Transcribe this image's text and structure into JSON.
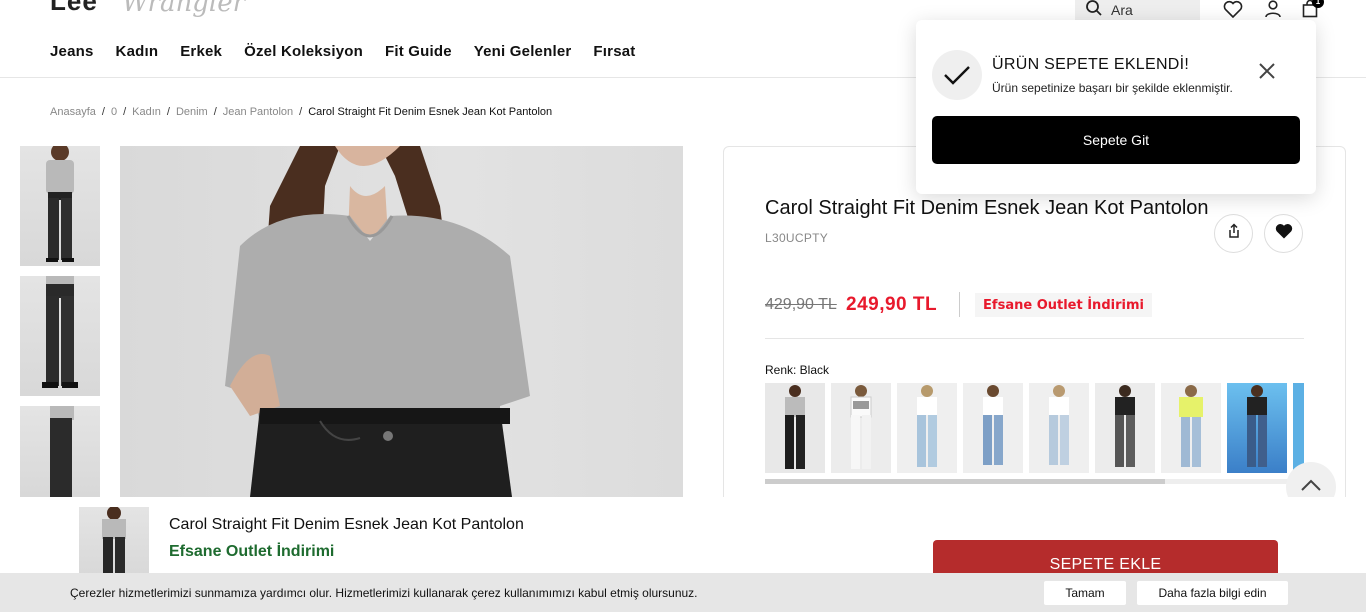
{
  "header": {
    "logo_primary": "Lee",
    "logo_secondary": "Wrangler",
    "search_placeholder": "Ara",
    "cart_count": "1",
    "nav": [
      "Jeans",
      "Kadın",
      "Erkek",
      "Özel Koleksiyon",
      "Fit Guide",
      "Yeni Gelenler",
      "Fırsat"
    ]
  },
  "breadcrumb": {
    "items": [
      "Anasayfa",
      "0",
      "Kadın",
      "Denim",
      "Jean Pantolon"
    ],
    "current": "Carol Straight Fit Denim Esnek Jean Kot Pantolon",
    "separator": "/"
  },
  "product": {
    "title": "Carol Straight Fit Denim Esnek Jean Kot Pantolon",
    "sku": "L30UCPTY",
    "old_price": "429,90 TL",
    "new_price": "249,90 TL",
    "promo": "Efsane Outlet İndirimi",
    "color_label": "Renk: Black",
    "price_color": "#e8192c"
  },
  "toast": {
    "title": "ÜRÜN SEPETE EKLENDİ!",
    "message": "Ürün sepetinize başarı bir şekilde eklenmiştir.",
    "button": "Sepete Git"
  },
  "sticky": {
    "title": "Carol Straight Fit Denim Esnek Jean Kot Pantolon",
    "promo": "Efsane Outlet İndirimi",
    "add_to_cart": "SEPETE EKLE",
    "add_color": "#b52c2c",
    "promo_color": "#1e6b2f"
  },
  "cookie": {
    "text": "Çerezler hizmetlerimizi sunmamıza yardımcı olur. Hizmetlerimizi kullanarak çerez kullanımımızı kabul etmiş olursunuz.",
    "ok": "Tamam",
    "more": "Daha fazla bilgi edin"
  }
}
